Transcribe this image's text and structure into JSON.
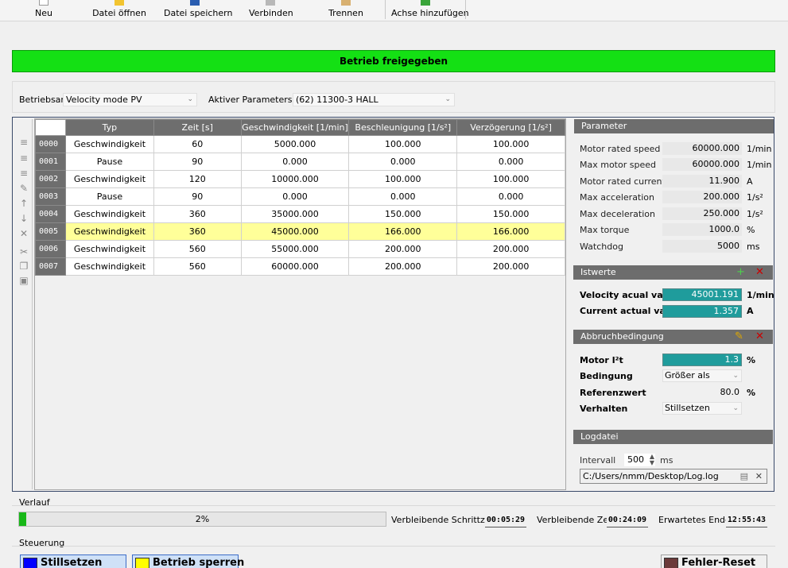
{
  "toolbar": {
    "items": [
      {
        "label": "Neu",
        "icon": "new-file-icon"
      },
      {
        "label": "Datei öffnen",
        "icon": "open-folder-icon"
      },
      {
        "label": "Datei speichern",
        "icon": "save-icon"
      },
      {
        "label": "Verbinden",
        "icon": "connect-icon"
      },
      {
        "label": "Trennen",
        "icon": "disconnect-icon"
      },
      {
        "label": "Achse hinzufügen",
        "icon": "add-axis-icon"
      }
    ]
  },
  "status": {
    "text": "Betrieb freigegeben",
    "color": "#14e014"
  },
  "mode": {
    "betriebsart_label": "Betriebsart",
    "betriebsart_value": "Velocity mode PV",
    "param_label": "Aktiver Parametersatz",
    "param_value": "(62) 11300-3 HALL"
  },
  "table": {
    "columns": [
      "Typ",
      "Zeit [s]",
      "Geschwindigkeit [1/min]",
      "Beschleunigung [1/s²]",
      "Verzögerung [1/s²]"
    ],
    "selected_row": 5,
    "rows": [
      {
        "id": "0000",
        "typ": "Geschwindigkeit",
        "zeit": "60",
        "gesch": "5000.000",
        "besch": "100.000",
        "verz": "100.000"
      },
      {
        "id": "0001",
        "typ": "Pause",
        "zeit": "90",
        "gesch": "0.000",
        "besch": "0.000",
        "verz": "0.000"
      },
      {
        "id": "0002",
        "typ": "Geschwindigkeit",
        "zeit": "120",
        "gesch": "10000.000",
        "besch": "100.000",
        "verz": "100.000"
      },
      {
        "id": "0003",
        "typ": "Pause",
        "zeit": "90",
        "gesch": "0.000",
        "besch": "0.000",
        "verz": "0.000"
      },
      {
        "id": "0004",
        "typ": "Geschwindigkeit",
        "zeit": "360",
        "gesch": "35000.000",
        "besch": "150.000",
        "verz": "150.000"
      },
      {
        "id": "0005",
        "typ": "Geschwindigkeit",
        "zeit": "360",
        "gesch": "45000.000",
        "besch": "166.000",
        "verz": "166.000"
      },
      {
        "id": "0006",
        "typ": "Geschwindigkeit",
        "zeit": "560",
        "gesch": "55000.000",
        "besch": "200.000",
        "verz": "200.000"
      },
      {
        "id": "0007",
        "typ": "Geschwindigkeit",
        "zeit": "560",
        "gesch": "60000.000",
        "besch": "200.000",
        "verz": "200.000"
      }
    ]
  },
  "parameter": {
    "title": "Parameter",
    "items": [
      {
        "label": "Motor rated speed",
        "value": "60000.000",
        "unit": "1/min"
      },
      {
        "label": "Max motor speed",
        "value": "60000.000",
        "unit": "1/min"
      },
      {
        "label": "Motor rated current",
        "value": "11.900",
        "unit": "A"
      },
      {
        "label": "Max acceleration",
        "value": "200.000",
        "unit": "1/s²"
      },
      {
        "label": "Max deceleration",
        "value": "250.000",
        "unit": "1/s²"
      },
      {
        "label": "Max torque",
        "value": "1000.0",
        "unit": "%"
      },
      {
        "label": "Watchdog",
        "value": "5000",
        "unit": "ms"
      }
    ]
  },
  "istwerte": {
    "title": "Istwerte",
    "items": [
      {
        "label": "Velocity acual value",
        "value": "45001.191",
        "unit": "1/min"
      },
      {
        "label": "Current actual value",
        "value": "1.357",
        "unit": "A"
      }
    ]
  },
  "abbruch": {
    "title": "Abbruchbedingung",
    "motor_label": "Motor I²t",
    "motor_value": "1.3",
    "motor_unit": "%",
    "bedingung_label": "Bedingung",
    "bedingung_value": "Größer als",
    "referenz_label": "Referenzwert",
    "referenz_value": "80.0",
    "referenz_unit": "%",
    "verhalten_label": "Verhalten",
    "verhalten_value": "Stillsetzen"
  },
  "logdatei": {
    "title": "Logdatei",
    "interval_label": "Intervall",
    "interval_value": "500",
    "interval_unit": "ms",
    "path": "C:/Users/nmm/Desktop/Log.log"
  },
  "verlauf": {
    "title": "Verlauf",
    "progress": 0.02,
    "progress_text": "2%",
    "schrittzeit_label": "Verbleibende Schrittzeit",
    "schrittzeit_value": "00:05:29",
    "zeit_label": "Verbleibende Zeit",
    "zeit_value": "00:24:09",
    "ende_label": "Erwartetes Ende",
    "ende_value": "12:55:43"
  },
  "steuerung": {
    "title": "Steuerung",
    "stillsetzen_label": "Stillsetzen",
    "stillsetzen_color": "#0000ff",
    "sperren_label": "Betrieb sperren",
    "sperren_color": "#ffff00",
    "reset_label": "Fehler-Reset",
    "reset_color": "#6b3a3a"
  }
}
